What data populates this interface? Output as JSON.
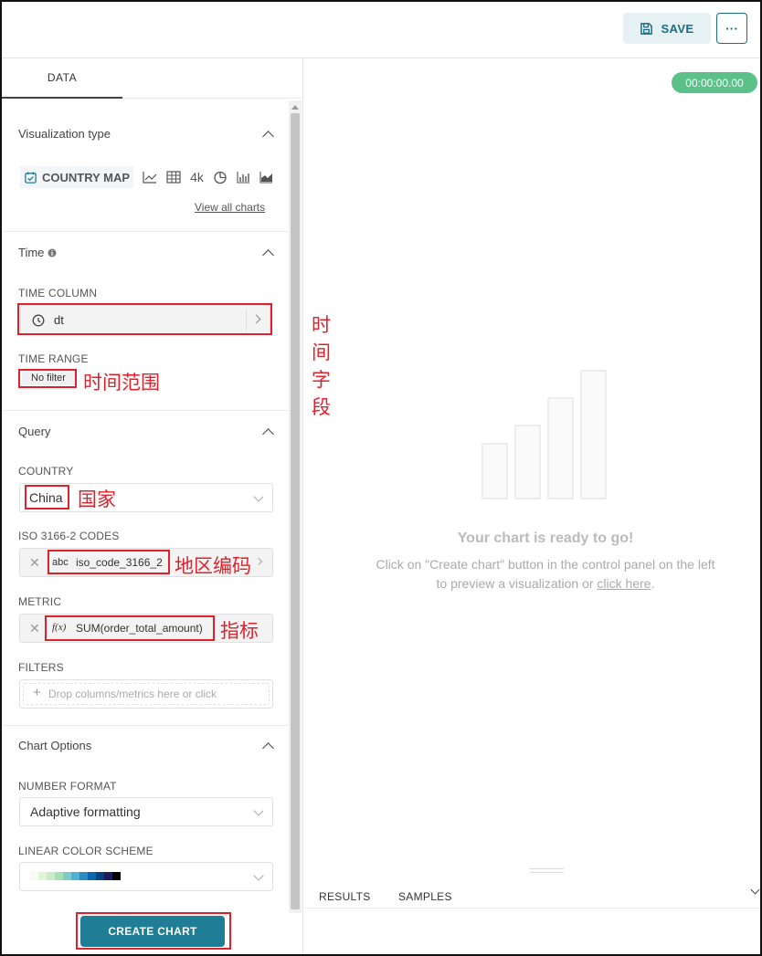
{
  "header": {
    "save_label": "SAVE",
    "more_label": "···"
  },
  "left_panel": {
    "tab_label": "DATA",
    "visualization": {
      "title": "Visualization type",
      "selected_label": "COUNTRY MAP",
      "other_icons": [
        "line-chart-icon",
        "table-icon",
        "big-number-icon",
        "pie-chart-icon",
        "bar-chart-icon",
        "area-chart-icon"
      ],
      "big_number_label": "4k",
      "view_all_label": "View all charts"
    },
    "time": {
      "title": "Time",
      "time_column_label": "TIME COLUMN",
      "time_column_value": "dt",
      "time_range_label": "TIME RANGE",
      "time_range_value": "No filter"
    },
    "query": {
      "title": "Query",
      "country_label": "COUNTRY",
      "country_value": "China",
      "iso_label": "ISO 3166-2 CODES",
      "iso_type_badge": "abc",
      "iso_value": "iso_code_3166_2",
      "metric_label": "METRIC",
      "metric_type_badge": "f(x)",
      "metric_value": "SUM(order_total_amount)",
      "filters_label": "FILTERS",
      "filters_placeholder": "Drop columns/metrics here or click"
    },
    "chart_options": {
      "title": "Chart Options",
      "number_format_label": "NUMBER FORMAT",
      "number_format_value": "Adaptive formatting",
      "color_scheme_label": "LINEAR COLOR SCHEME",
      "color_scheme_swatches": [
        "#f7fcf0",
        "#e0f3db",
        "#ccebc5",
        "#a8ddb5",
        "#7bccc4",
        "#4eb3d3",
        "#2b8cbe",
        "#0868ac",
        "#084081",
        "#1c1c5a",
        "#000000"
      ]
    },
    "create_button_label": "CREATE CHART"
  },
  "annotations": {
    "time_column_note": "时间字段",
    "time_range_note": "时间范围",
    "country_note": "国家",
    "iso_note": "地区编码",
    "metric_note": "指标"
  },
  "right_panel": {
    "timer": "00:00:00.00",
    "ready_title": "Your chart is ready to go!",
    "ready_desc_line1": "Click on \"Create chart\" button in the control panel on the left",
    "ready_desc_line2_prefix": "to preview a visualization or ",
    "ready_desc_link": "click here",
    "ready_desc_suffix": ".",
    "tabs": [
      "RESULTS",
      "SAMPLES"
    ]
  },
  "colors": {
    "accent": "#1f7d95",
    "annotation_red": "#e0202a",
    "timer_green": "#5ac189"
  }
}
